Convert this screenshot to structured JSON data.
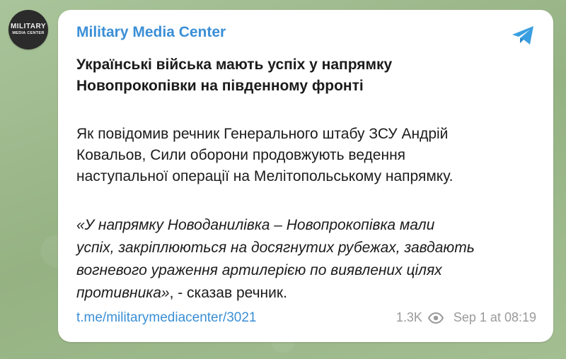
{
  "channel": {
    "name": "Military Media Center",
    "avatar_line1": "MILITARY",
    "avatar_line2": "MEDIA CENTER"
  },
  "post": {
    "title_lines": [
      "Українські війська мають успіх у напрямку",
      "Новопрокопівки на південному фронті"
    ],
    "body_lines": [
      "Як повідомив речник Генерального штабу ЗСУ Андрій",
      "Ковальов, Сили оборони продовжують ведення",
      "наступальної операції на Мелітопольському напрямку."
    ],
    "quote_lines": [
      "«У напрямку Новоданилівка – Новопрокопівка мали",
      "успіх, закріплюються на досягнутих рубежах, завдають",
      "вогневого ураження артилерією по виявлених цілях"
    ],
    "quote_last_italic": "противника»",
    "quote_last_plain": ", - сказав речник.",
    "link": "t.me/militarymediacenter/3021",
    "views": "1.3K",
    "date": "Sep 1 at 08:19"
  },
  "icons": {
    "telegram": "telegram-icon",
    "views": "eye-icon"
  },
  "colors": {
    "accent": "#3a8fd6",
    "meta": "#9a9a9a",
    "background": "#9fb98f"
  }
}
